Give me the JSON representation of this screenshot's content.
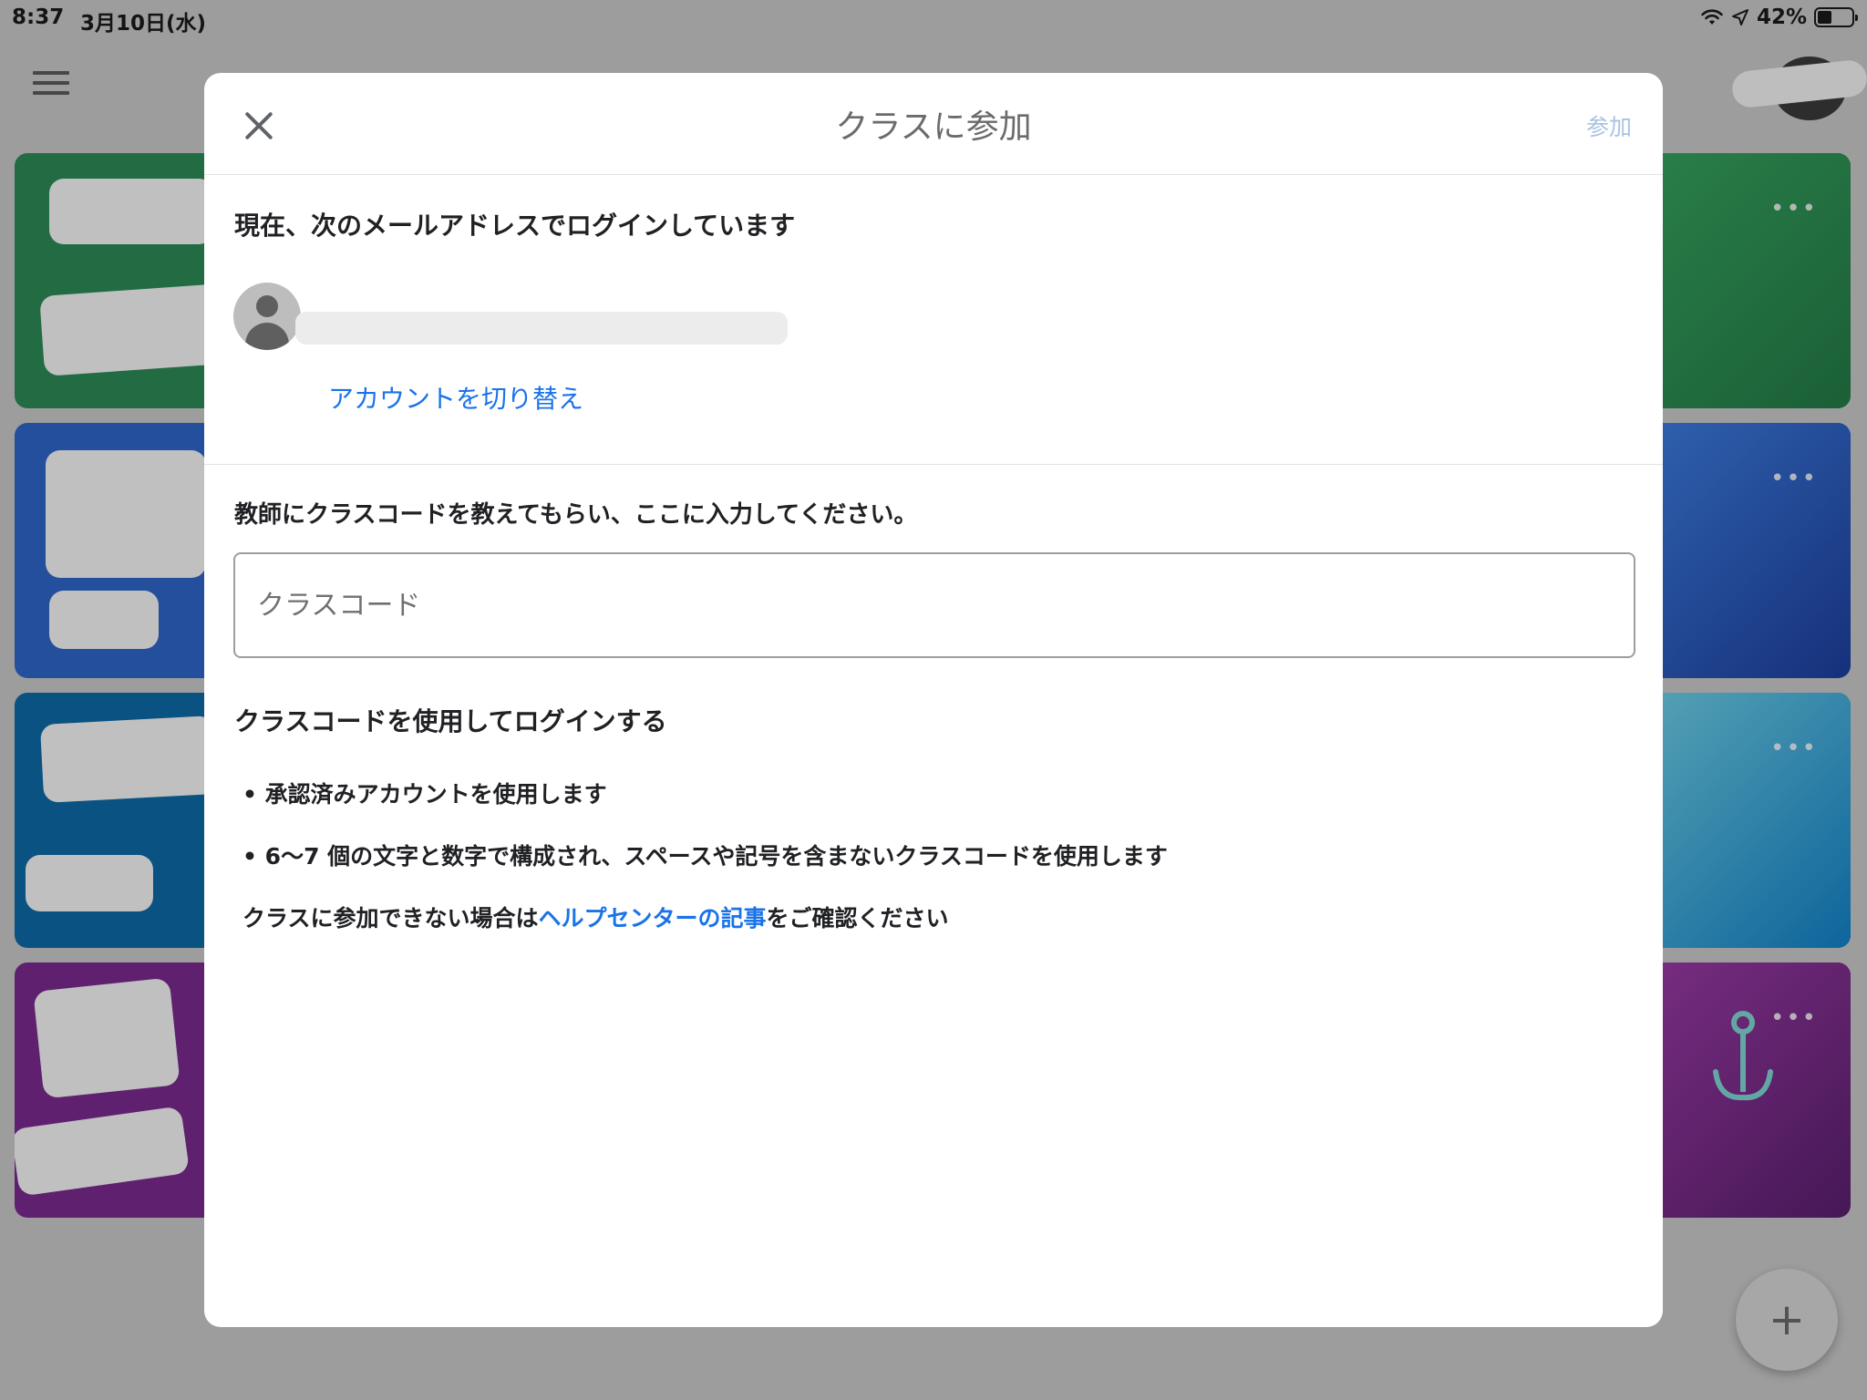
{
  "status_bar": {
    "time": "8:37",
    "date": "3月10日(水)",
    "battery": "42%",
    "battery_level": 0.42
  },
  "background": {
    "fab_label": "+",
    "card_more_label": "•••",
    "card_colors": [
      "#2e8b57",
      "#2f66c9",
      "#0c6aa6",
      "#7a2a8f"
    ]
  },
  "dialog": {
    "title": "クラスに参加",
    "join_label": "参加",
    "account": {
      "heading": "現在、次のメールアドレスでログインしています",
      "switch_label": "アカウントを切り替え"
    },
    "code": {
      "instruction": "教師にクラスコードを教えてもらい、ここに入力してください。",
      "placeholder": "クラスコード",
      "value": ""
    },
    "login": {
      "heading": "クラスコードを使用してログインする",
      "bullets": [
        "• 承認済みアカウントを使用します",
        "• 6〜7 個の文字と数字で構成され、スペースや記号を含まないクラスコードを使用します"
      ],
      "help_prefix": "クラスに参加できない場合は",
      "help_link": "ヘルプセンターの記事",
      "help_suffix": "をご確認ください"
    }
  },
  "colors": {
    "link": "#1a73e8",
    "join_disabled": "#a9c3e4"
  }
}
